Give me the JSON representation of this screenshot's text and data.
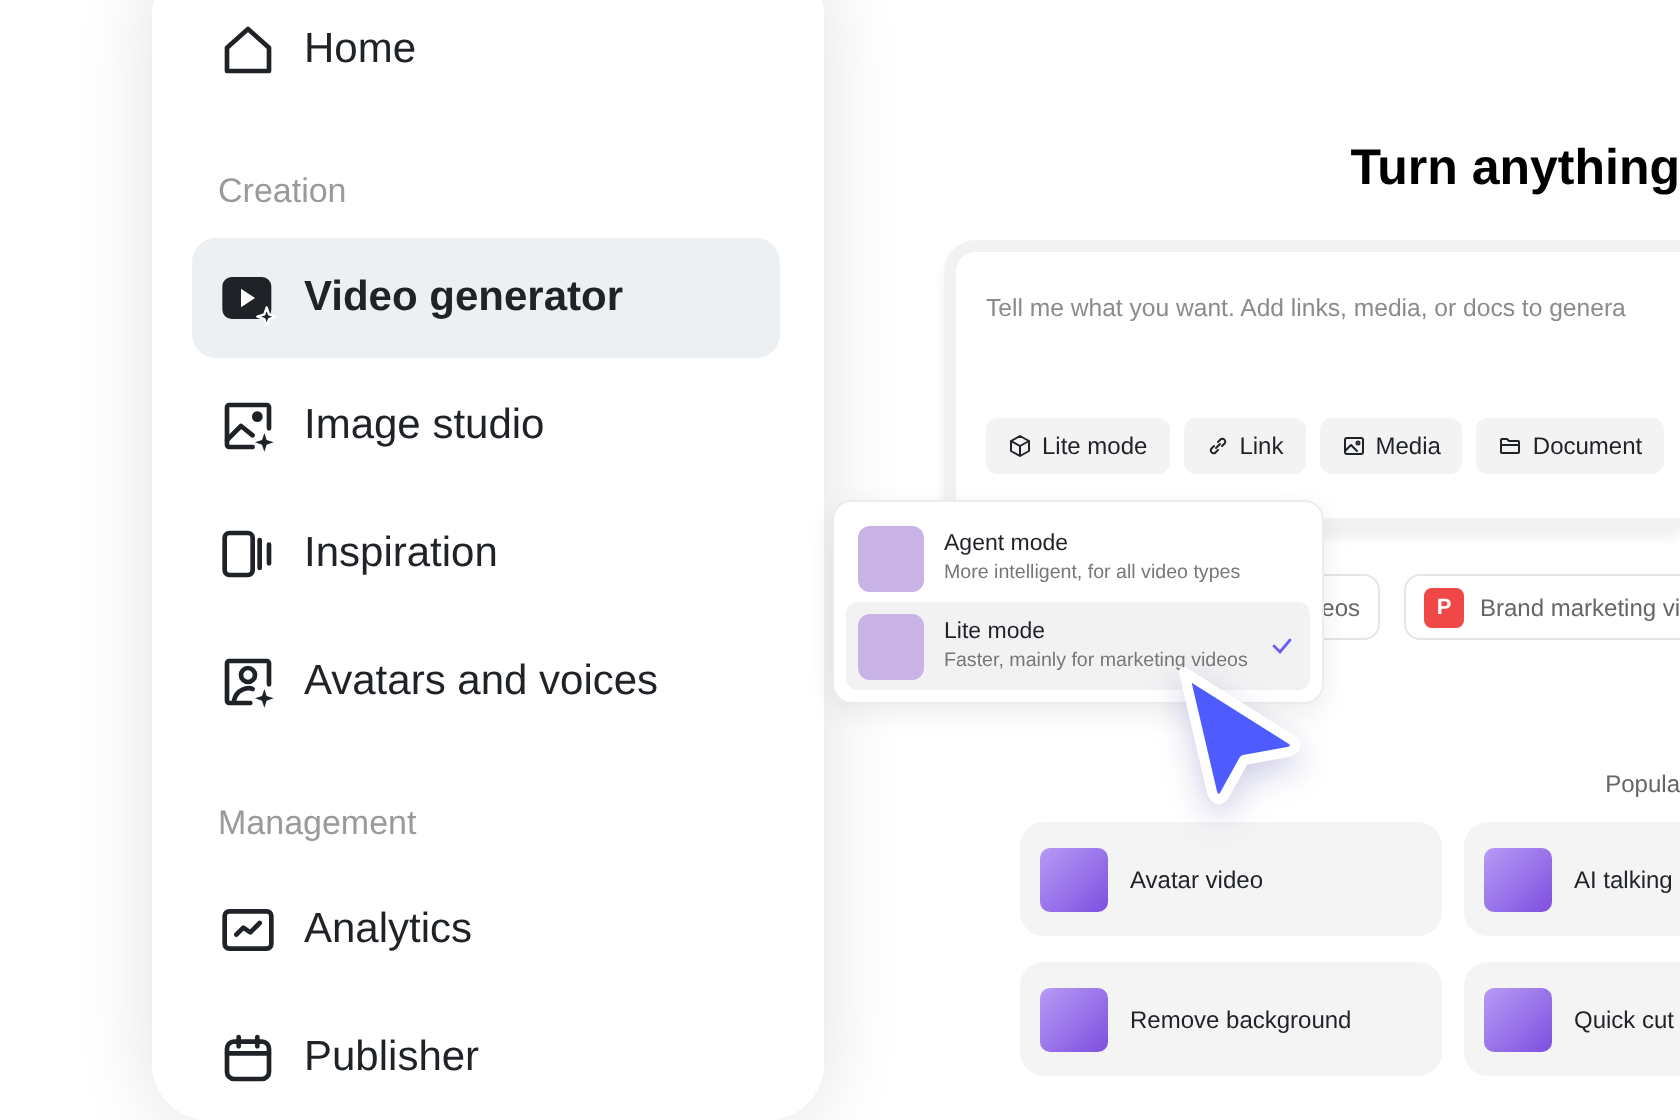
{
  "sidebar": {
    "home": {
      "label": "Home",
      "selected": false
    },
    "sections": [
      {
        "title": "Creation",
        "items": [
          {
            "label": "Video generator",
            "selected": true
          },
          {
            "label": "Image studio",
            "selected": false
          },
          {
            "label": "Inspiration",
            "selected": false
          },
          {
            "label": "Avatars and voices",
            "selected": false
          }
        ]
      },
      {
        "title": "Management",
        "items": [
          {
            "label": "Analytics",
            "selected": false
          },
          {
            "label": "Publisher",
            "selected": false
          }
        ]
      }
    ]
  },
  "main": {
    "title": "Turn anything",
    "prompt": {
      "placeholder": "Tell me what you want. Add links, media, or docs to genera",
      "buttons": [
        {
          "label": "Lite mode"
        },
        {
          "label": "Link"
        },
        {
          "label": "Media"
        },
        {
          "label": "Document"
        }
      ]
    },
    "chips": [
      {
        "label": "eos"
      },
      {
        "label": "Brand marketing vi",
        "badge": "P"
      }
    ],
    "popular_label": "Popula",
    "tools": [
      {
        "label": "Avatar video"
      },
      {
        "label": "AI talking"
      },
      {
        "label": "Remove background"
      },
      {
        "label": "Quick cut"
      }
    ]
  },
  "mode_menu": {
    "items": [
      {
        "title": "Agent mode",
        "subtitle": "More intelligent, for all video types",
        "selected": false
      },
      {
        "title": "Lite mode",
        "subtitle": "Faster, mainly for marketing videos",
        "selected": true
      }
    ]
  }
}
